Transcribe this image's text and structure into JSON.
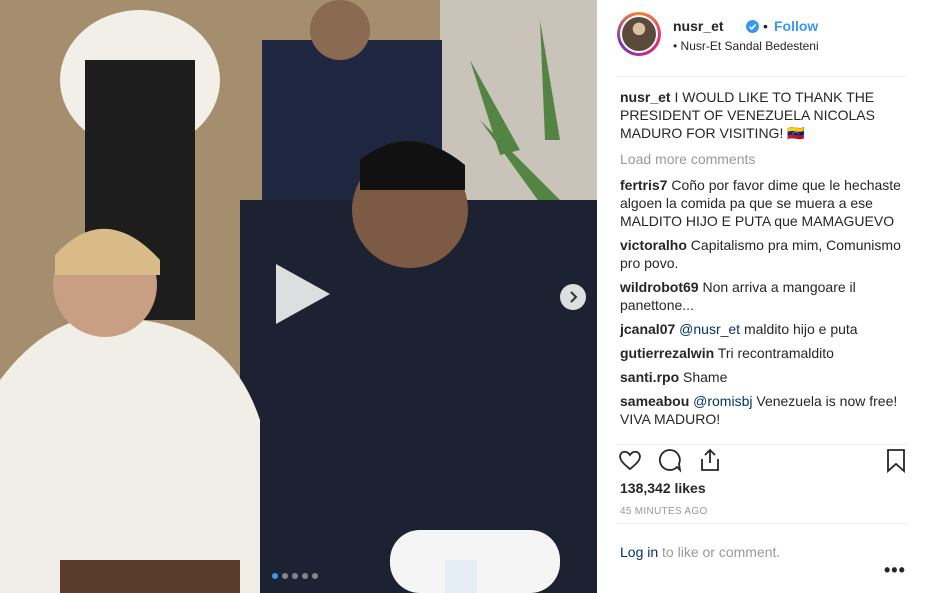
{
  "post": {
    "username": "nusr_et",
    "follow_label": "Follow",
    "separator": "•",
    "location": "• Nusr-Et Sandal Bedesteni"
  },
  "caption": {
    "user": "nusr_et",
    "text": "I WOULD LIKE TO THANK THE PRESIDENT OF VENEZUELA NICOLAS MADURO FOR VISITING! 🇻🇪"
  },
  "load_more": "Load more comments",
  "comments": [
    {
      "user": "fertris7",
      "mention": "",
      "text": "Coño por favor dime que le hechaste algoen la comida pa que se muera a ese MALDITO HIJO E PUTA que MAMAGUEVO"
    },
    {
      "user": "victoralho",
      "mention": "",
      "text": "Capitalismo pra mim, Comunismo pro povo."
    },
    {
      "user": "wildrobot69",
      "mention": "",
      "text": "Non arriva a mangoare il panettone..."
    },
    {
      "user": "jcanal07",
      "mention": "@nusr_et",
      "text": "maldito hijo e puta"
    },
    {
      "user": "gutierrezalwin",
      "mention": "",
      "text": "Tri recontramaldito"
    },
    {
      "user": "santi.rpo",
      "mention": "",
      "text": "Shame"
    },
    {
      "user": "sameabou",
      "mention": "@romisbj",
      "text": "Venezuela is now free! VIVA MADURO!"
    }
  ],
  "likes": "138,342 likes",
  "time": "45 MINUTES AGO",
  "login": {
    "link": "Log in",
    "text": " to like or comment."
  },
  "more": "•••",
  "carousel": {
    "count": 5,
    "active": 0
  },
  "colors": {
    "accent": "#3897f0",
    "muted": "#999999",
    "verified": "#3897f0"
  },
  "icons": [
    "heart-icon",
    "comment-icon",
    "share-icon",
    "bookmark-icon",
    "play-icon",
    "chevron-right-icon",
    "verified-icon"
  ]
}
